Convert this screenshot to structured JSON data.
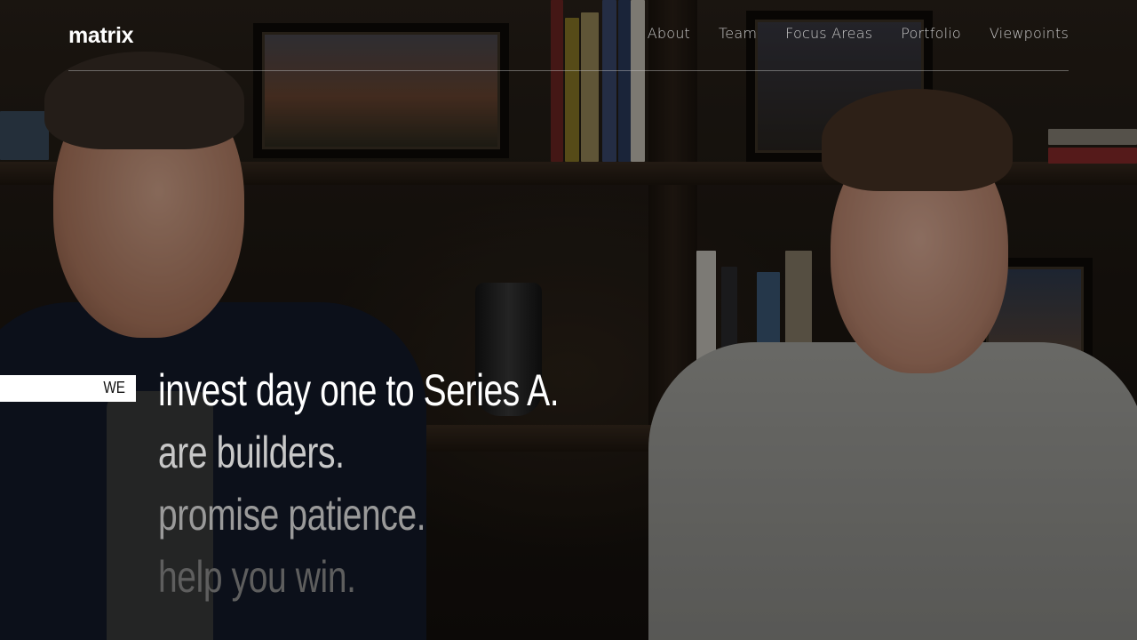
{
  "brand": {
    "logo_text": "matrix"
  },
  "nav": {
    "items": [
      {
        "label": "About"
      },
      {
        "label": "Team"
      },
      {
        "label": "Focus Areas"
      },
      {
        "label": "Portfolio"
      },
      {
        "label": "Viewpoints"
      }
    ]
  },
  "hero": {
    "prefix": "WE",
    "lines": [
      "invest day one to Series A.",
      "are builders.",
      "promise patience.",
      "help you win."
    ]
  },
  "colors": {
    "header_text": "#c9c9c9",
    "prefix_bg": "#ffffff",
    "line_active": "#ffffff"
  }
}
